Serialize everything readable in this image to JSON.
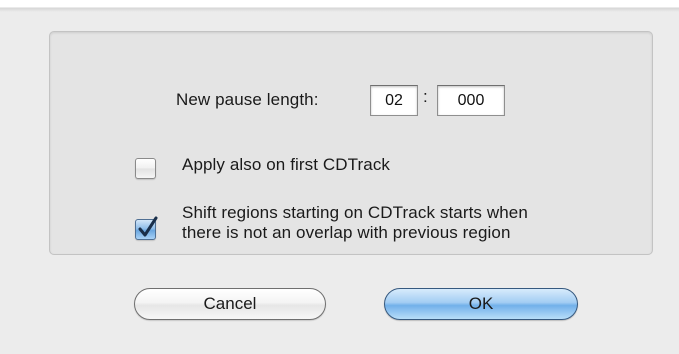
{
  "dialog": {
    "pause_length": {
      "label": "New pause length:",
      "minutes": "02",
      "separator": ":",
      "milliseconds": "000"
    },
    "options": [
      {
        "label": "Apply also on first CDTrack",
        "checked": false
      },
      {
        "label_line1": "Shift regions starting on CDTrack starts when",
        "label_line2": "there is not an overlap with previous region",
        "checked": true
      }
    ],
    "buttons": {
      "cancel": "Cancel",
      "ok": "OK"
    },
    "colors": {
      "accent": "#72b0ea",
      "check_mark": "#1a2f4a"
    }
  }
}
